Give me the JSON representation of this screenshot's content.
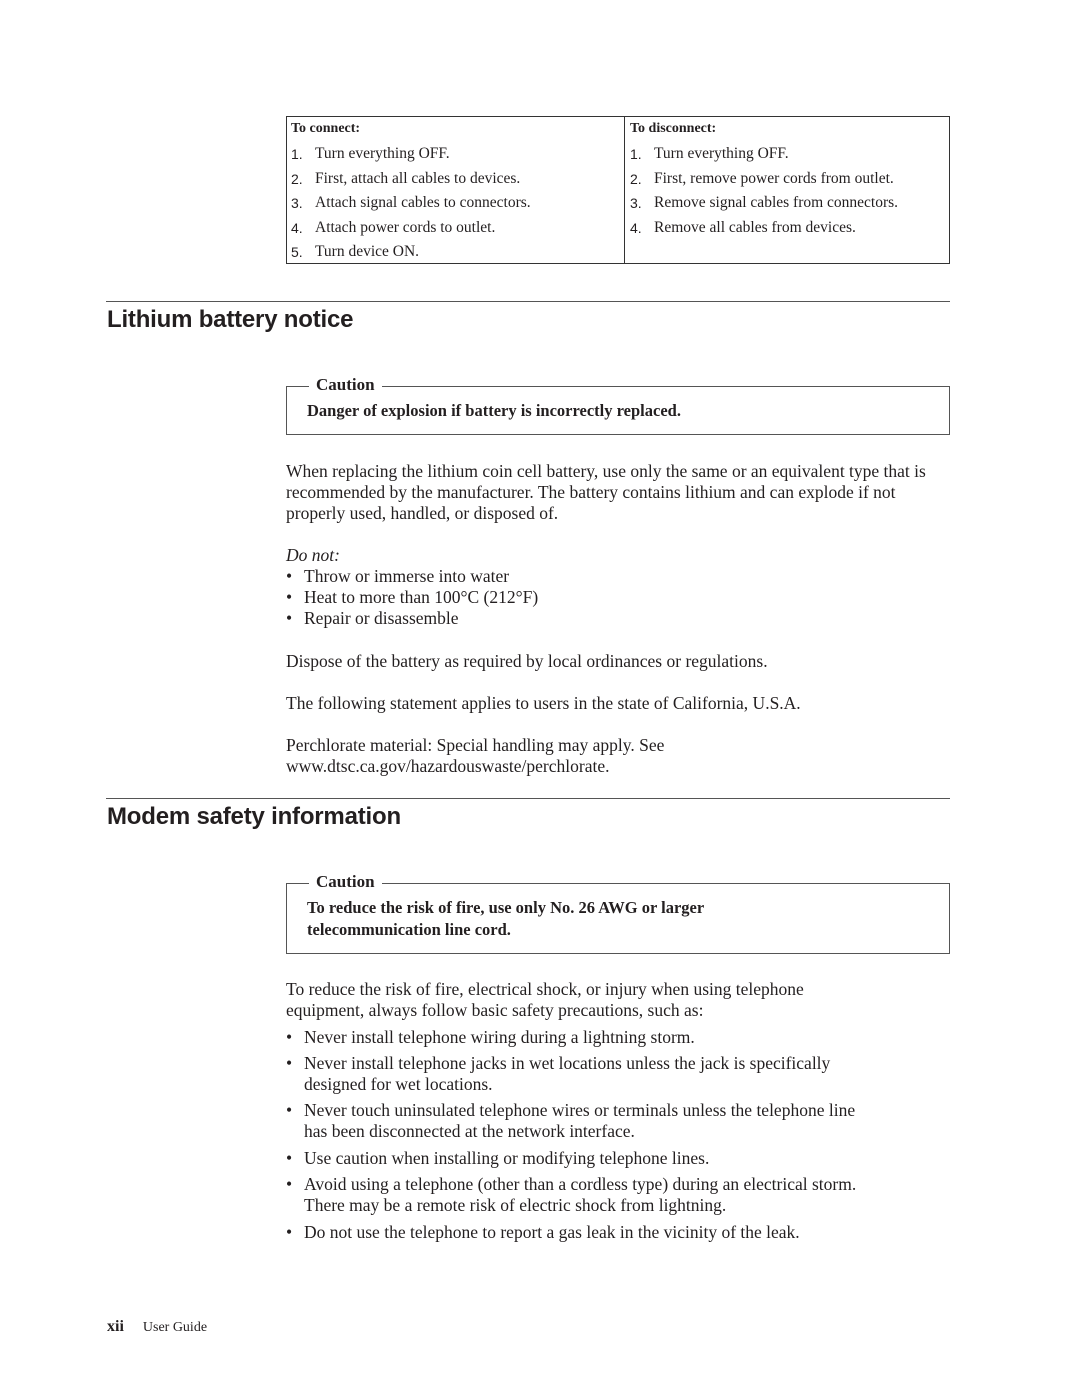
{
  "cable_table": {
    "connect": {
      "heading": "To connect:",
      "steps": [
        {
          "num": "1.",
          "text": "Turn everything OFF."
        },
        {
          "num": "2.",
          "text": "First, attach all cables to devices."
        },
        {
          "num": "3.",
          "text": "Attach signal cables to connectors."
        },
        {
          "num": "4.",
          "text": "Attach power cords to outlet."
        },
        {
          "num": "5.",
          "text": "Turn device ON."
        }
      ]
    },
    "disconnect": {
      "heading": "To disconnect:",
      "steps": [
        {
          "num": "1.",
          "text": "Turn everything OFF."
        },
        {
          "num": "2.",
          "text": "First, remove power cords from outlet."
        },
        {
          "num": "3.",
          "text": "Remove signal cables from connectors."
        },
        {
          "num": "4.",
          "text": "Remove all cables from devices."
        }
      ]
    }
  },
  "lithium": {
    "title": "Lithium battery notice",
    "caution": {
      "label": "Caution",
      "message": "Danger of explosion if battery is incorrectly replaced."
    },
    "intro": "When replacing the lithium coin cell battery, use only the same or an equivalent type that is recommended by the manufacturer. The battery contains lithium and can explode if not properly used, handled, or disposed of.",
    "do_not_label": "Do not:",
    "do_not_items": [
      "Throw or immerse into water",
      "Heat to more than 100°C (212°F)",
      "Repair or disassemble"
    ],
    "dispose": "Dispose of the battery as required by local ordinances or regulations.",
    "california": "The following statement applies to users in the state of California, U.S.A.",
    "perchlorate_line1": "Perchlorate material: Special handling may apply. See",
    "perchlorate_line2": "www.dtsc.ca.gov/hazardouswaste/perchlorate."
  },
  "modem": {
    "title": "Modem safety information",
    "caution": {
      "label": "Caution",
      "message_line1": "To reduce the risk of fire, use only No. 26 AWG or larger",
      "message_line2": "telecommunication line cord."
    },
    "intro_line1": "To reduce the risk of fire, electrical shock, or injury when using telephone",
    "intro_line2": "equipment, always follow basic safety precautions, such as:",
    "bullet_symbol": "•",
    "items": [
      {
        "line1": "Never install telephone wiring during a lightning storm.",
        "line2": ""
      },
      {
        "line1": "Never install telephone jacks in wet locations unless the jack is specifically",
        "line2": "designed for wet locations."
      },
      {
        "line1": "Never touch uninsulated telephone wires or terminals unless the telephone line",
        "line2": "has been disconnected at the network interface."
      },
      {
        "line1": "Use caution when installing or modifying telephone lines.",
        "line2": ""
      },
      {
        "line1": "Avoid using a telephone (other than a cordless type) during an electrical storm.",
        "line2": "There may be a remote risk of electric shock from lightning."
      },
      {
        "line1": "Do not use the telephone to report a gas leak in the vicinity of the leak.",
        "line2": ""
      }
    ]
  },
  "footer": {
    "page_number": "xii",
    "doc_title": "User Guide"
  }
}
